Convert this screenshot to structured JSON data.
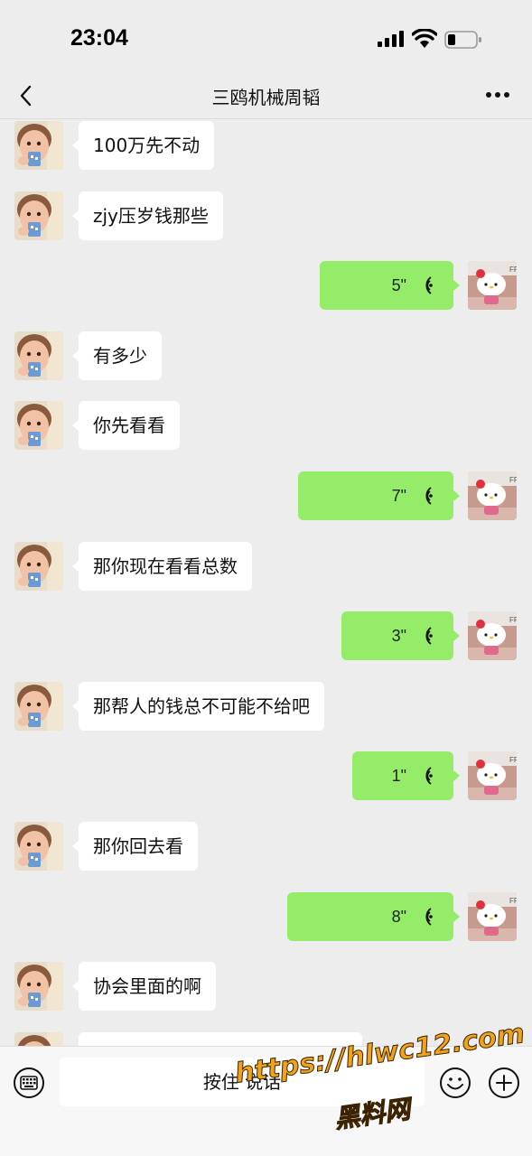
{
  "status_bar": {
    "time": "23:04"
  },
  "header": {
    "title": "三鸥机械周韬"
  },
  "colors": {
    "outgoing_bubble": "#95ec69",
    "incoming_bubble": "#ffffff",
    "background": "#ededed",
    "watermark": "#f0a21a"
  },
  "icons": {
    "back": "chevron-left-icon",
    "more": "more-dots-icon",
    "voice": "voice-wave-icon",
    "keyboard": "keyboard-icon",
    "emoji": "emoji-icon",
    "plus": "plus-icon"
  },
  "messages": [
    {
      "dir": "in",
      "type": "text",
      "text": "100万先不动"
    },
    {
      "dir": "in",
      "type": "text",
      "text": "zjy压岁钱那些"
    },
    {
      "dir": "out",
      "type": "voice",
      "duration": "5\""
    },
    {
      "dir": "in",
      "type": "text",
      "text": "有多少"
    },
    {
      "dir": "in",
      "type": "text",
      "text": "你先看看"
    },
    {
      "dir": "out",
      "type": "voice",
      "duration": "7\""
    },
    {
      "dir": "in",
      "type": "text",
      "text": "那你现在看看总数"
    },
    {
      "dir": "out",
      "type": "voice",
      "duration": "3\""
    },
    {
      "dir": "in",
      "type": "text",
      "text": "那帮人的钱总不可能不给吧"
    },
    {
      "dir": "out",
      "type": "voice",
      "duration": "1\""
    },
    {
      "dir": "in",
      "type": "text",
      "text": "那你回去看"
    },
    {
      "dir": "out",
      "type": "voice",
      "duration": "8\""
    },
    {
      "dir": "in",
      "type": "text",
      "text": "协会里面的啊"
    },
    {
      "dir": "in",
      "type": "text",
      "text": ""
    }
  ],
  "input_bar": {
    "hold_to_talk": "按住 说话"
  },
  "watermark": {
    "url": "https://hlwc12.com",
    "name": "黑料网"
  }
}
